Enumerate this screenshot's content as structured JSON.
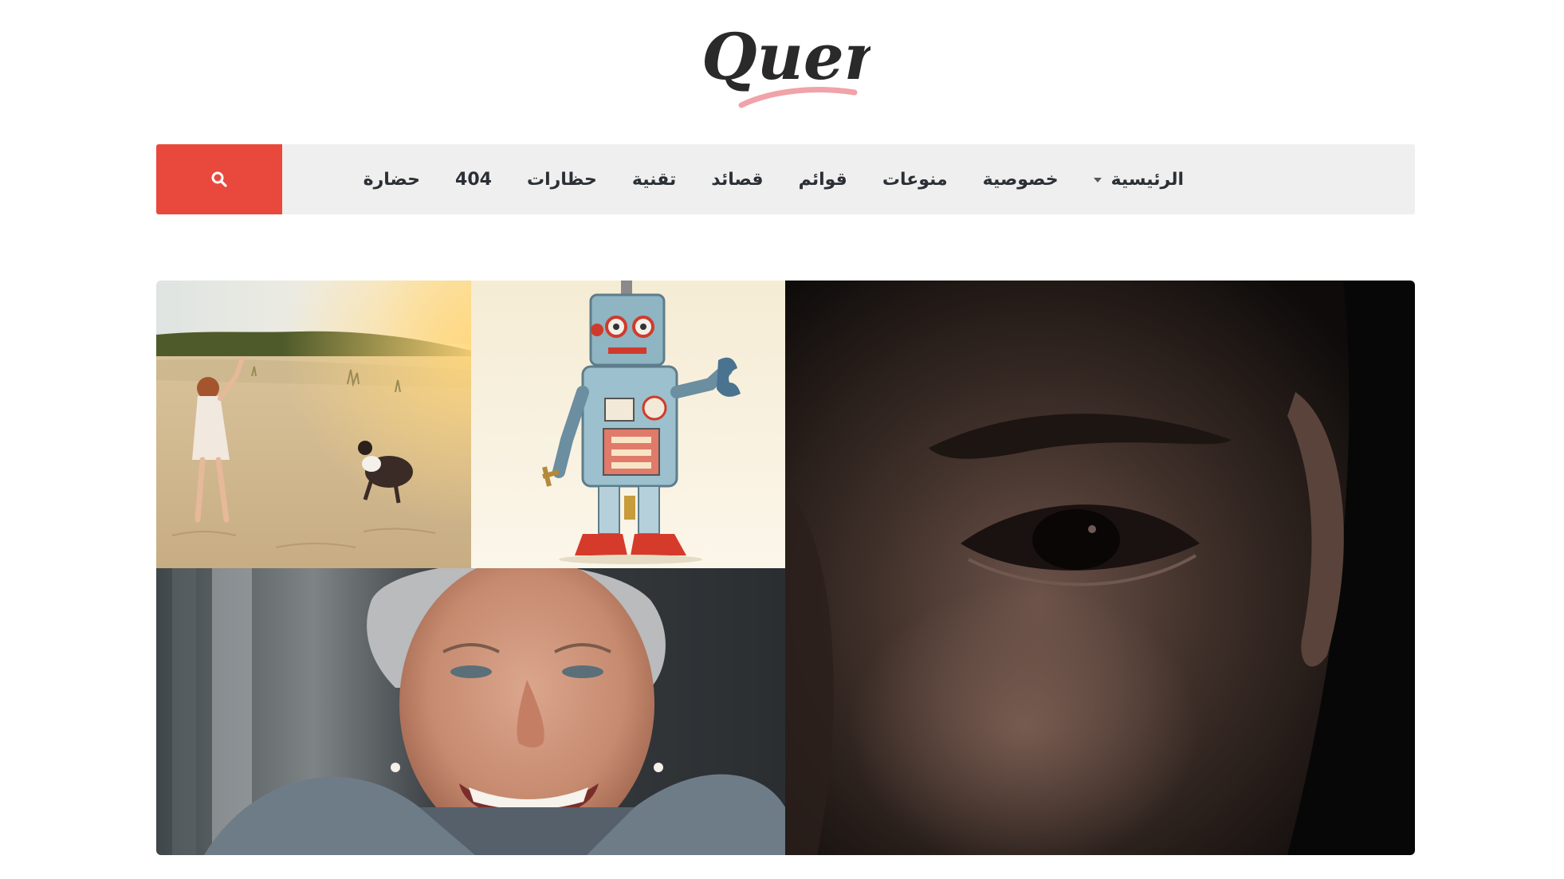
{
  "site": {
    "logo_text": "Query",
    "accent_color": "#e8493c",
    "logo_underline_color": "#f0a3a8"
  },
  "nav": {
    "search_icon": "search-icon",
    "items": [
      {
        "label": "الرئيسية",
        "has_dropdown": true
      },
      {
        "label": "خصوصية"
      },
      {
        "label": "منوعات"
      },
      {
        "label": "قوائم"
      },
      {
        "label": "قصائد"
      },
      {
        "label": "تقنية"
      },
      {
        "label": "حظارات"
      },
      {
        "label": "404"
      },
      {
        "label": "حضارة"
      }
    ]
  },
  "featured": {
    "images": [
      {
        "name": "girl-with-dog-on-beach"
      },
      {
        "name": "toy-robot"
      },
      {
        "name": "smiling-elderly-woman"
      },
      {
        "name": "close-up-face-eye"
      }
    ]
  }
}
